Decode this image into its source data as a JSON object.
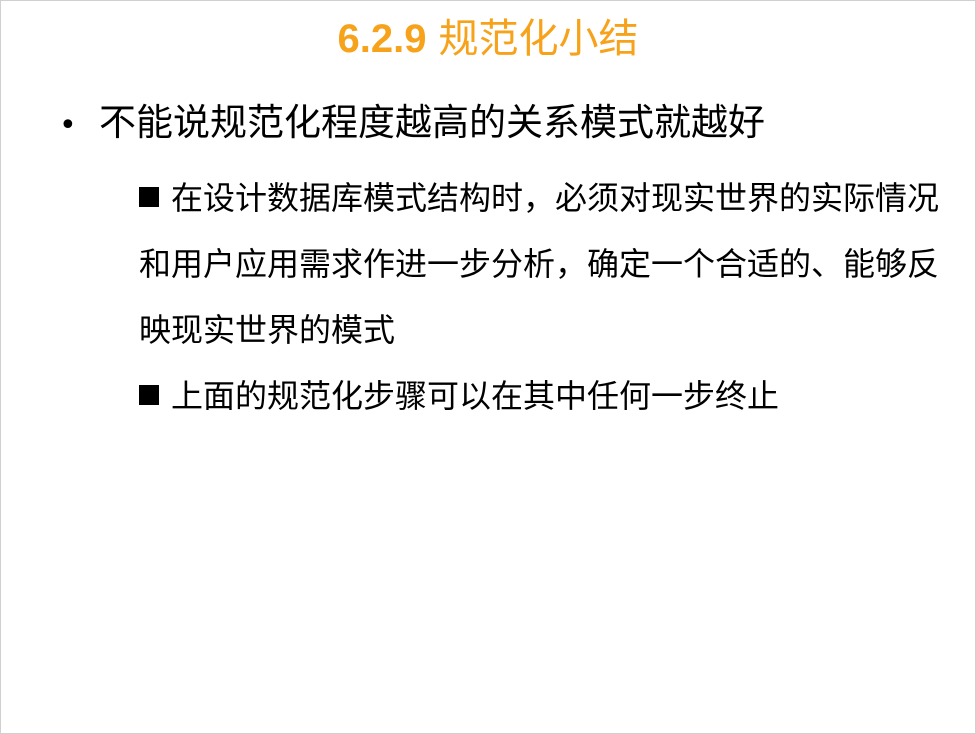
{
  "slide": {
    "title_number": "6.2.9",
    "title_text": "规范化小结",
    "colors": {
      "title": "#f7a21b",
      "text": "#000000"
    },
    "bullet": {
      "marker": "•",
      "text": "不能说规范化程度越高的关系模式就越好"
    },
    "sub_items": [
      {
        "text": "在设计数据库模式结构时，必须对现实世界的实际情况和用户应用需求作进一步分析，确定一个合适的、能够反映现实世界的模式"
      },
      {
        "text": "上面的规范化步骤可以在其中任何一步终止"
      }
    ]
  }
}
